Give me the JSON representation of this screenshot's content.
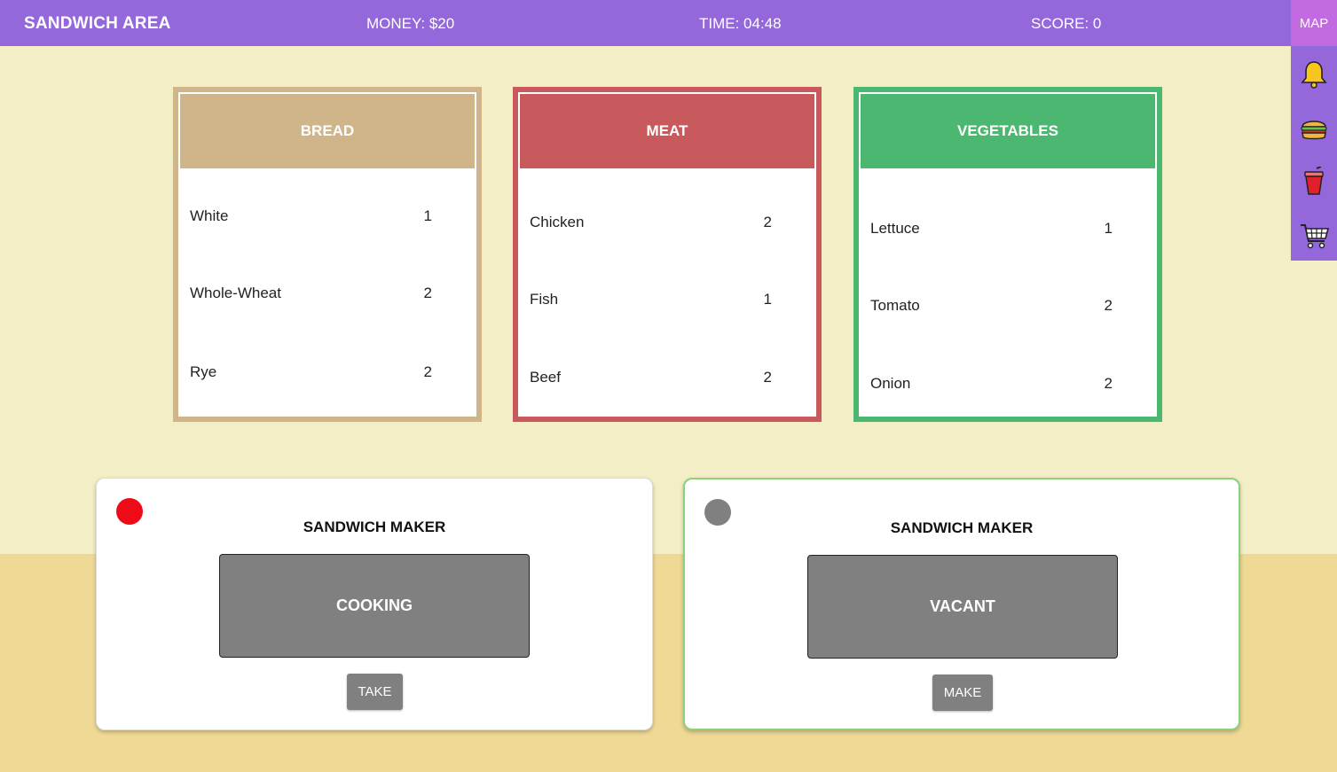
{
  "header": {
    "title": "SANDWICH AREA",
    "money": "MONEY: $20",
    "time": "TIME: 04:48",
    "score": "SCORE: 0"
  },
  "sidebar": {
    "map_label": "MAP",
    "icons": [
      "bell-icon",
      "sandwich-icon",
      "drink-cup-icon",
      "shopping-cart-icon"
    ]
  },
  "bins": [
    {
      "label": "BREAD",
      "color": "#d0b48a",
      "items": [
        {
          "name": "White",
          "qty": "1"
        },
        {
          "name": "Whole-Wheat",
          "qty": "2"
        },
        {
          "name": "Rye",
          "qty": "2"
        }
      ]
    },
    {
      "label": "MEAT",
      "color": "#c85a5e",
      "items": [
        {
          "name": "Chicken",
          "qty": "2"
        },
        {
          "name": "Fish",
          "qty": "1"
        },
        {
          "name": "Beef",
          "qty": "2"
        }
      ]
    },
    {
      "label": "VEGETABLES",
      "color": "#4cb771",
      "items": [
        {
          "name": "Lettuce",
          "qty": "1"
        },
        {
          "name": "Tomato",
          "qty": "2"
        },
        {
          "name": "Onion",
          "qty": "2"
        }
      ]
    }
  ],
  "makers": [
    {
      "title": "SANDWICH MAKER",
      "status": "COOKING",
      "button": "TAKE",
      "light_color": "#ee0a17"
    },
    {
      "title": "SANDWICH MAKER",
      "status": "VACANT",
      "button": "MAKE",
      "light_color": "#808080"
    }
  ],
  "colors": {
    "header_bg": "#9467db",
    "map_bg": "#c26be0",
    "accent_border": "#8fd07a"
  }
}
